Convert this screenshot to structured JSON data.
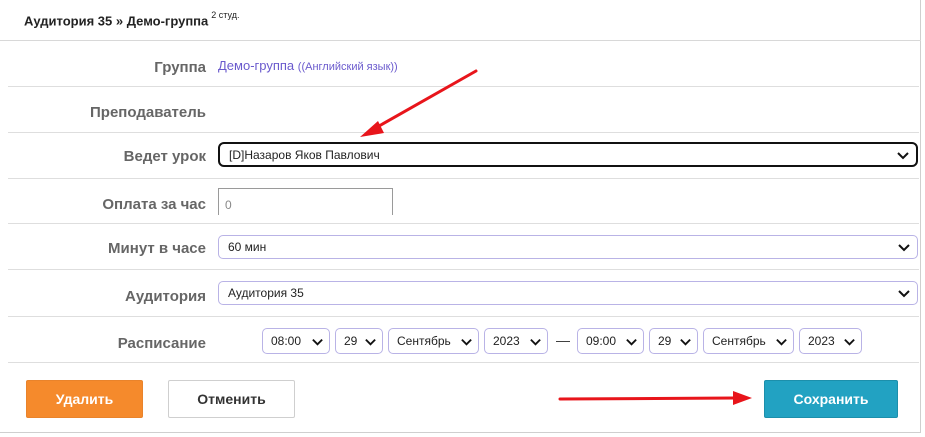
{
  "header": {
    "title": "Аудитория 35 » Демо-группа",
    "students": "2 студ."
  },
  "form": {
    "group": {
      "label": "Группа",
      "link_text": "Демо-группа",
      "link_subtext": "((Английский язык))"
    },
    "teacher": {
      "label": "Преподаватель"
    },
    "leads_lesson": {
      "label": "Ведет урок",
      "value": "[D]Назаров Яков Павлович"
    },
    "hourly_rate": {
      "label": "Оплата за час",
      "value": "0"
    },
    "minutes_per_hour": {
      "label": "Минут в часе",
      "value": "60 мин"
    },
    "room": {
      "label": "Аудитория",
      "value": "Аудитория 35"
    },
    "schedule": {
      "label": "Расписание",
      "start": {
        "time": "08:00",
        "day": "29",
        "month": "Сентябрь",
        "year": "2023"
      },
      "separator": "—",
      "end": {
        "time": "09:00",
        "day": "29",
        "month": "Сентябрь",
        "year": "2023"
      }
    }
  },
  "buttons": {
    "delete": "Удалить",
    "cancel": "Отменить",
    "save": "Сохранить"
  },
  "colors": {
    "delete_bg": "#f58a2c",
    "save_bg": "#22a2c2",
    "link": "#6a5acd",
    "annotation_arrow": "#e8151b"
  },
  "icons": {
    "select_chevron": "chevron-down-icon",
    "annotation": "red-arrow-annotation"
  }
}
